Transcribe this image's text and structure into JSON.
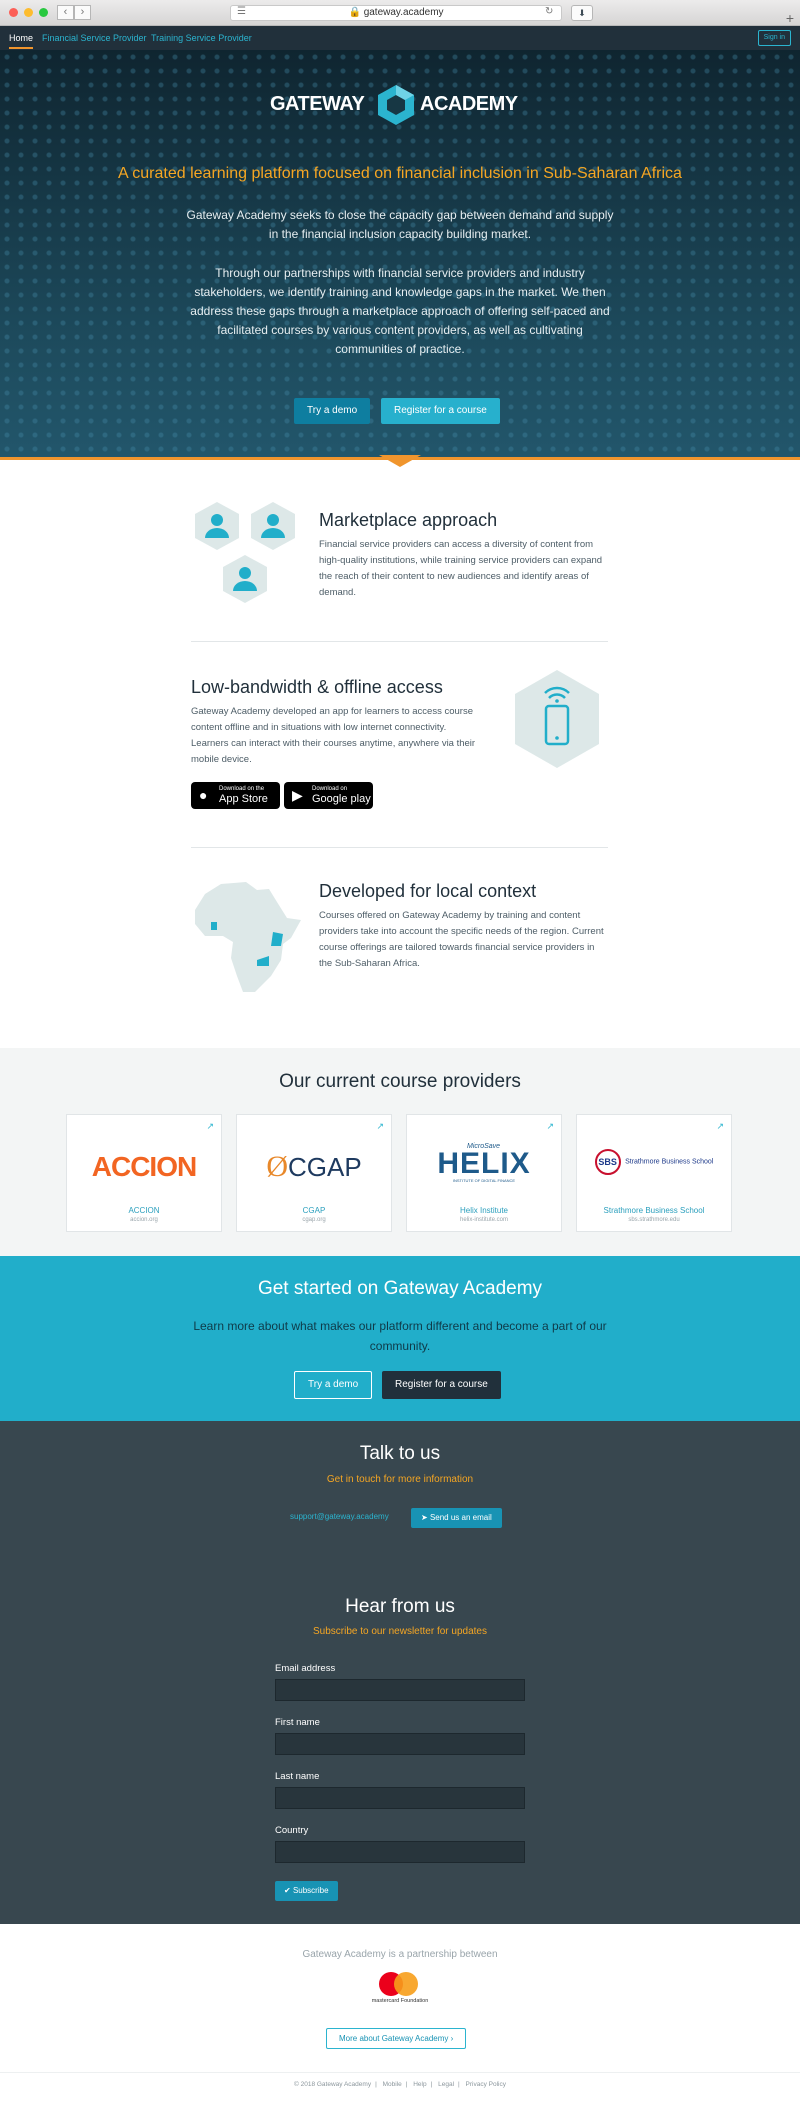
{
  "browser": {
    "url": "gatewayacademy",
    "url_display": "gateway.academy"
  },
  "nav": {
    "items": [
      "Home",
      "Financial Service Provider",
      "Training Service Provider"
    ],
    "signin": "Sign in"
  },
  "hero": {
    "logo_left": "GATEWAY",
    "logo_right": "ACADEMY",
    "tagline": "A curated learning platform focused on financial inclusion in Sub-Saharan Africa",
    "p1": "Gateway Academy seeks to close the capacity gap between demand and supply in the financial inclusion capacity building market.",
    "p2": "Through our partnerships with financial service providers and industry stakeholders, we identify training and knowledge gaps in the market. We then address these gaps through a marketplace approach of offering self-paced and facilitated courses by various content providers, as well as cultivating communities of practice.",
    "demo_btn": "Try a demo",
    "register_btn": "Register for a course"
  },
  "features": [
    {
      "title": "Marketplace approach",
      "text": "Financial service providers can access a diversity of content from high-quality institutions, while training service providers can expand the reach of their content to new audiences and identify areas of demand."
    },
    {
      "title": "Low-bandwidth & offline access",
      "text": "Gateway Academy developed an app for learners to access course content offline and in situations with low internet connectivity. Learners can interact with their courses anytime, anywhere via their mobile device."
    },
    {
      "title": "Developed for local context",
      "text": "Courses offered on Gateway Academy by training and content providers take into account the specific needs of the region. Current course offerings are tailored towards financial service providers in the Sub-Saharan Africa."
    }
  ],
  "stores": {
    "apple_small": "Download on the",
    "apple_big": "App Store",
    "google_small": "Download on",
    "google_big": "Google play"
  },
  "providers": {
    "title": "Our current course providers",
    "items": [
      {
        "name": "ACCION",
        "url": "accion.org",
        "logo": "ACCION"
      },
      {
        "name": "CGAP",
        "url": "cgap.org",
        "logo": "CGAP"
      },
      {
        "name": "Helix Institute",
        "url": "helix-institute.com",
        "logo": "HELIX",
        "logo_small": "MicroSave",
        "logo_sub": "INSTITUTE OF DIGITAL FINANCE"
      },
      {
        "name": "Strathmore Business School",
        "url": "sbs.strathmore.edu",
        "logo": "Strathmore Business School",
        "logo_mark": "SBS"
      }
    ]
  },
  "started": {
    "title": "Get started on Gateway Academy",
    "text": "Learn more about what makes our platform different and become a part of our community.",
    "demo_btn": "Try a demo",
    "register_btn": "Register for a course"
  },
  "talk": {
    "title": "Talk to us",
    "subtitle": "Get in touch for more information",
    "email": "support@gateway.academy",
    "send_btn": "Send us an email"
  },
  "newsletter": {
    "title": "Hear from us",
    "subtitle": "Subscribe to our newsletter for updates",
    "fields": [
      "Email address",
      "First name",
      "Last name",
      "Country"
    ],
    "submit": "Subscribe"
  },
  "footer": {
    "partner_text": "Gateway Academy is a partnership between",
    "partner_name": "mastercard Foundation",
    "more_btn": "More about Gateway Academy",
    "links": [
      "© 2018 Gateway Academy",
      "Mobile",
      "Help",
      "Legal",
      "Privacy Policy"
    ]
  },
  "colors": {
    "accent": "#21aeca",
    "orange": "#f0952d",
    "dark": "#21303b",
    "footer_dark": "#38474f"
  }
}
